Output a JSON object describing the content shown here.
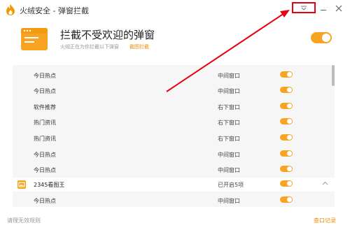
{
  "window": {
    "title": "火绒安全 - 弹窗拦截",
    "menu_icon": "dropdown-menu-icon",
    "minimize_icon": "minimize-icon",
    "close_icon": "close-icon"
  },
  "header": {
    "title": "拦截不受欢迎的弹窗",
    "subtitle": "火绒正在为你拦截以下弹窗",
    "link": "截图拦截",
    "enabled": true
  },
  "groups": [
    {
      "items": [
        {
          "name": "今日热点",
          "mode": "中间窗口",
          "enabled": true
        },
        {
          "name": "今日热点",
          "mode": "中间窗口",
          "enabled": true
        },
        {
          "name": "软件推荐",
          "mode": "右下窗口",
          "enabled": true
        },
        {
          "name": "热门资讯",
          "mode": "右下窗口",
          "enabled": true
        },
        {
          "name": "热门资讯",
          "mode": "右下窗口",
          "enabled": true
        },
        {
          "name": "今日热点",
          "mode": "中间窗口",
          "enabled": true
        },
        {
          "name": "今日热点",
          "mode": "中间窗口",
          "enabled": true
        }
      ]
    },
    {
      "name": "2345看图王",
      "mode": "已开启5项",
      "enabled": true,
      "expanded": true,
      "items": [
        {
          "name": "今日热点",
          "mode": "中间窗口",
          "enabled": true
        }
      ]
    }
  ],
  "footer": {
    "left": "请理无效规则",
    "right": "查口记录"
  },
  "colors": {
    "accent": "#f6a421",
    "annotation": "#e60012"
  }
}
